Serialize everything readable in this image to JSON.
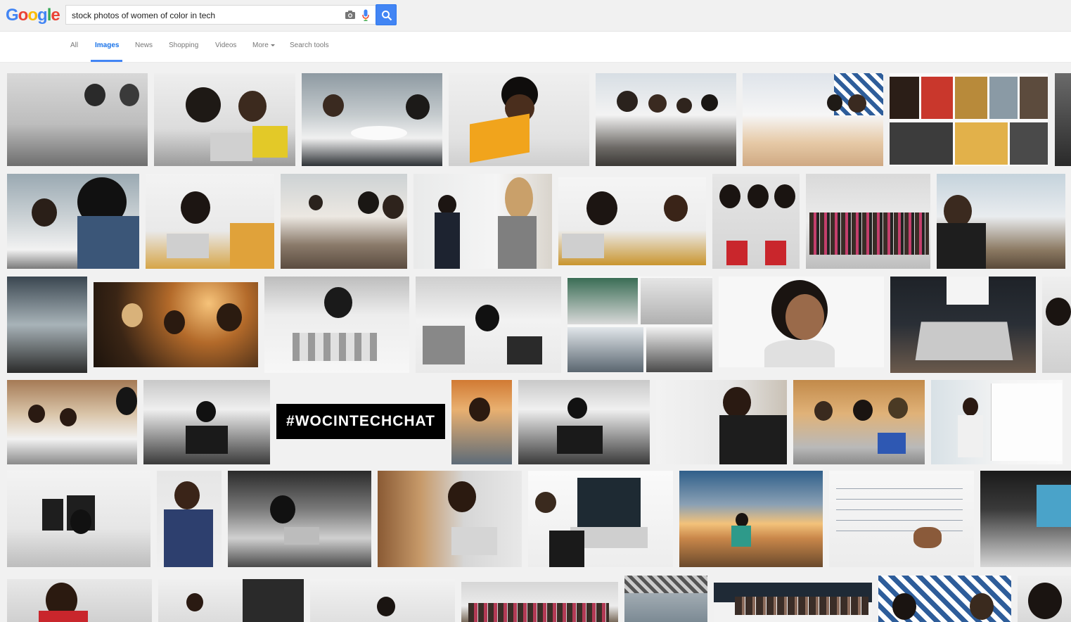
{
  "header": {
    "logo_letters": [
      "G",
      "o",
      "o",
      "g",
      "l",
      "e"
    ],
    "logo_colors": [
      "#4285f4",
      "#ea4335",
      "#fbbc05",
      "#4285f4",
      "#34a853",
      "#ea4335"
    ],
    "search_value": "stock photos of women of color in tech",
    "camera_icon": "camera-icon",
    "mic_icon": "mic-icon",
    "search_icon": "search-icon"
  },
  "nav": {
    "tabs": [
      {
        "label": "All"
      },
      {
        "label": "Images"
      },
      {
        "label": "News"
      },
      {
        "label": "Shopping"
      },
      {
        "label": "Videos"
      },
      {
        "label": "More"
      },
      {
        "label": "Search tools"
      }
    ],
    "active_tab": "Images"
  },
  "results": {
    "banner_text": "#WOCINTECHCHAT"
  },
  "colors": {
    "accent": "#4285f4",
    "active_tab_text": "#1a73e8"
  }
}
